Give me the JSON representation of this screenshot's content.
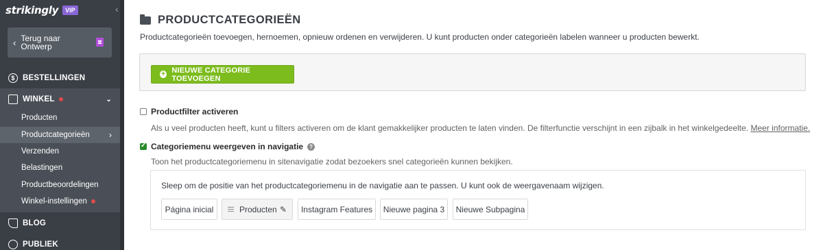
{
  "brand": {
    "logo_text": "strikingly",
    "badge": "VIP"
  },
  "sidebar": {
    "back_button": "Terug naar Ontwerp",
    "bestellingen": "BESTELLINGEN",
    "winkel": "WINKEL",
    "winkel_items": [
      "Producten",
      "Productcategorieën",
      "Verzenden",
      "Belastingen",
      "Productbeoordelingen",
      "Winkel-instellingen"
    ],
    "blog": "BLOG",
    "publiek": "PUBLIEK",
    "colors": {
      "bg": "#3a3e45",
      "group_bg": "#4a4f57",
      "active_bg": "#5e646c",
      "alert": "#e04a4a"
    }
  },
  "main": {
    "title": "PRODUCTCATEGORIEËN",
    "intro": "Productcategorieën toevoegen, hernoemen, opnieuw ordenen en verwijderen. U kunt producten onder categorieën labelen wanneer u producten bewerkt.",
    "add_button": "NIEUWE CATEGORIE TOEVOEGEN",
    "filter": {
      "label": "Productfilter activeren",
      "checked": false,
      "desc": "Als u veel producten heeft, kunt u filters activeren om de klant gemakkelijker producten te laten vinden. De filterfunctie verschijnt in een zijbalk in het winkelgedeelte.",
      "link": "Meer informatie."
    },
    "menu_option": {
      "label": "Categoriemenu weergeven in navigatie",
      "checked": true,
      "desc": "Toon het productcategoriemenu in sitenavigatie zodat bezoekers snel categorieën kunnen bekijken."
    },
    "nav_panel": {
      "hint": "Sleep om de positie van het productcategoriemenu in de navigatie aan te passen. U kunt ook de weergavenaam wijzigen.",
      "items": [
        "Página inicial",
        "Producten",
        "Instagram Features",
        "Nieuwe pagina 3",
        "Nieuwe Subpagina"
      ]
    },
    "colors": {
      "accent": "#7cbc1d",
      "checkbox": "#2a8a2a"
    }
  }
}
